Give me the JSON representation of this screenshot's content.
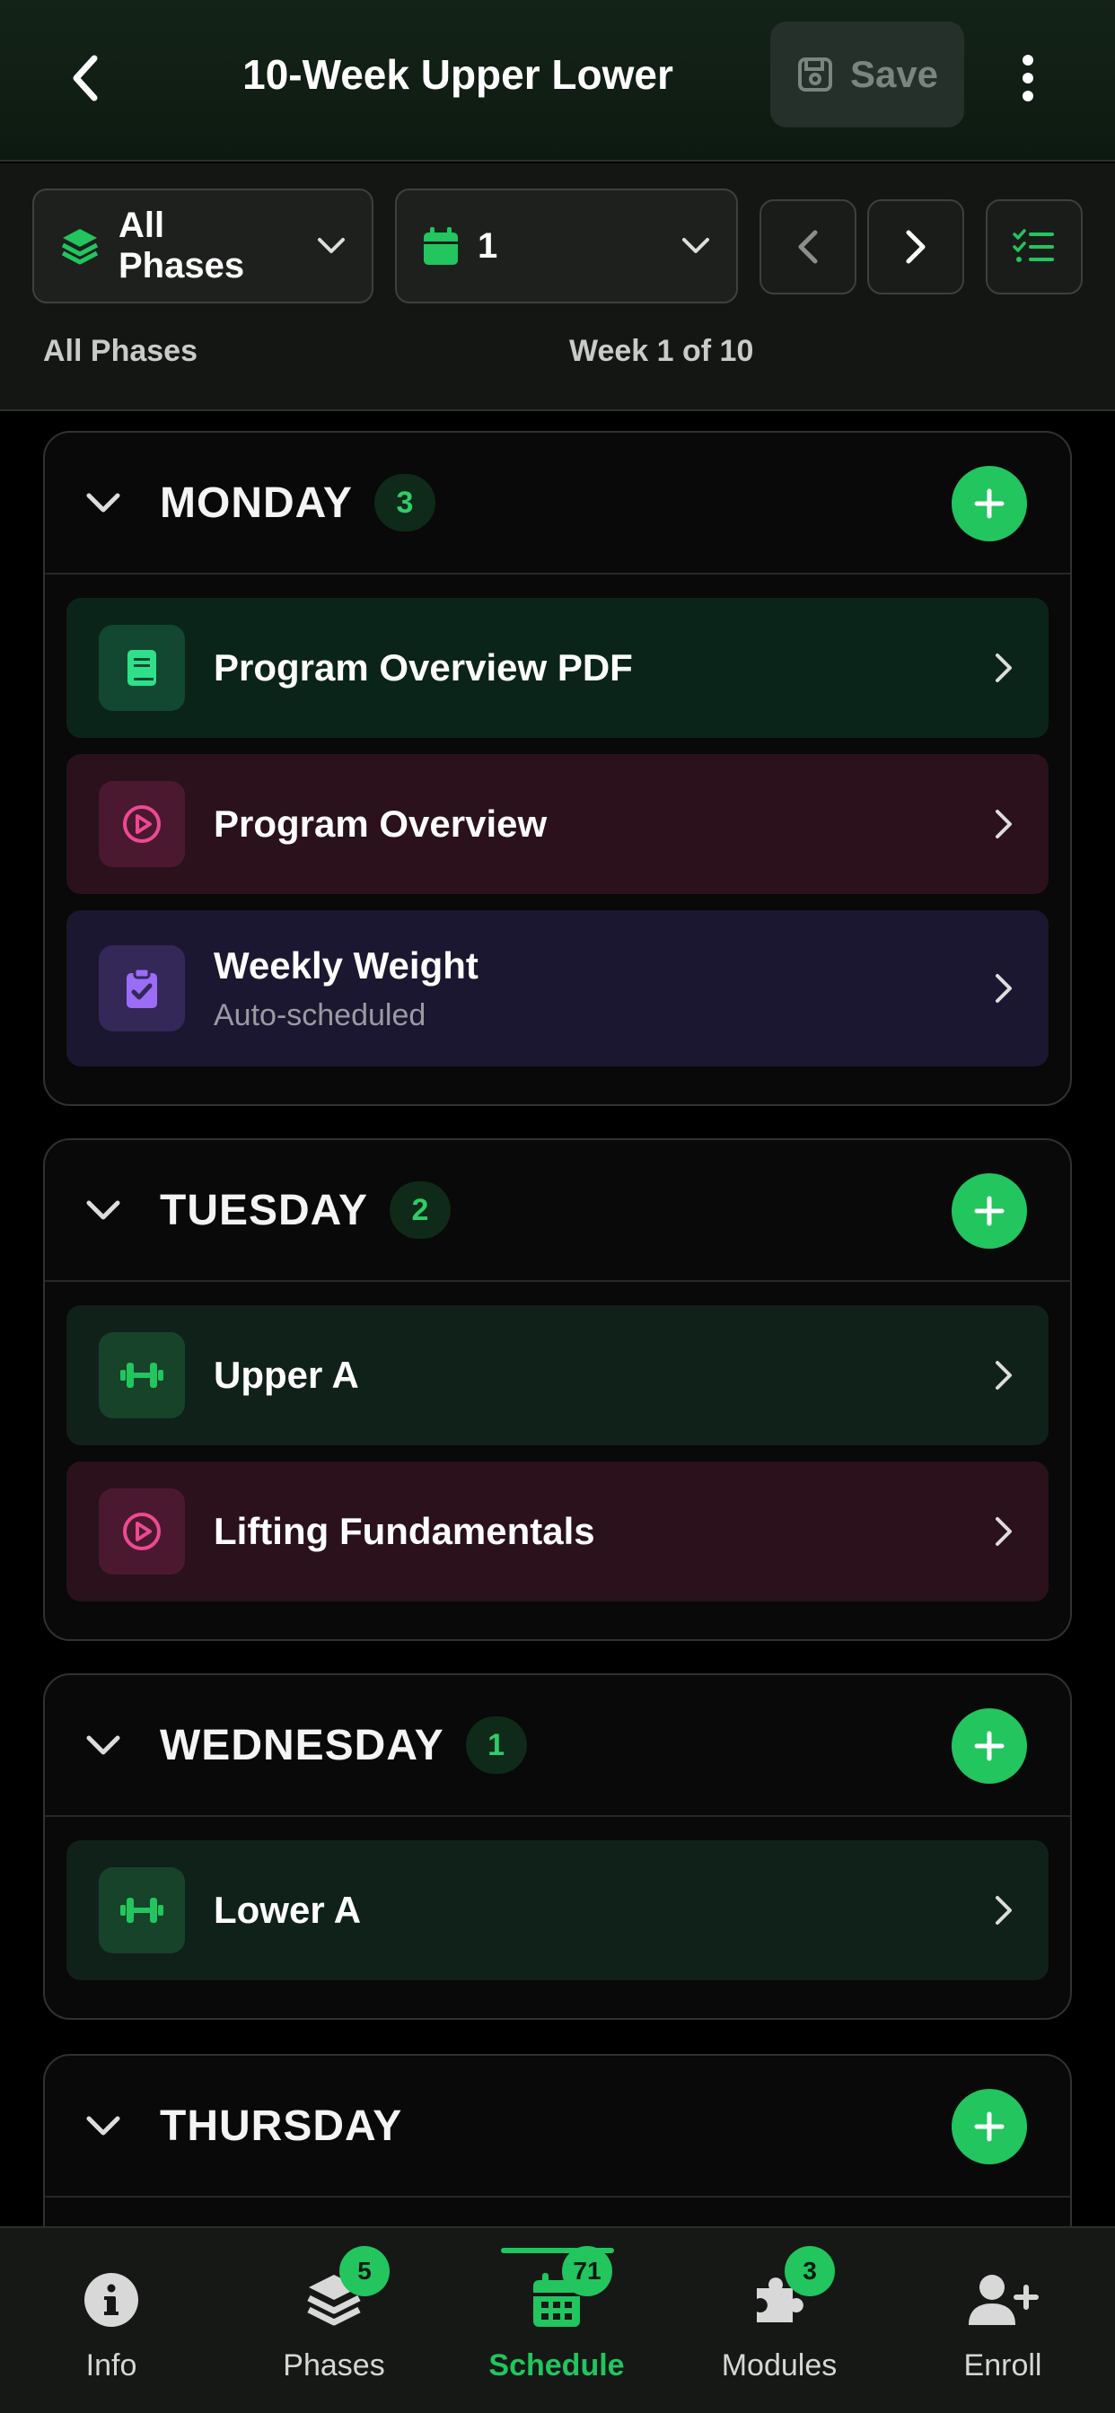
{
  "header": {
    "title": "10-Week Upper Lower",
    "save_label": "Save"
  },
  "toolbar": {
    "phase_select": "All Phases",
    "week_select": "1",
    "phase_caption": "All Phases",
    "week_caption": "Week 1 of 10"
  },
  "days": [
    {
      "name": "MONDAY",
      "count": "3",
      "items": [
        {
          "title": "Program Overview PDF",
          "subtitle": "",
          "icon": "document-icon",
          "kind": "document"
        },
        {
          "title": "Program Overview",
          "subtitle": "",
          "icon": "play-circle-icon",
          "kind": "video"
        },
        {
          "title": "Weekly Weight",
          "subtitle": "Auto-scheduled",
          "icon": "clipboard-check-icon",
          "kind": "check-in"
        }
      ]
    },
    {
      "name": "TUESDAY",
      "count": "2",
      "items": [
        {
          "title": "Upper A",
          "subtitle": "",
          "icon": "dumbbell-icon",
          "kind": "workout"
        },
        {
          "title": "Lifting Fundamentals",
          "subtitle": "",
          "icon": "play-circle-icon",
          "kind": "video"
        }
      ]
    },
    {
      "name": "WEDNESDAY",
      "count": "1",
      "items": [
        {
          "title": "Lower A",
          "subtitle": "",
          "icon": "dumbbell-icon",
          "kind": "workout"
        }
      ]
    },
    {
      "name": "THURSDAY",
      "count": "",
      "items": []
    }
  ],
  "bottom_nav": {
    "tabs": [
      {
        "label": "Info",
        "badge": "",
        "icon": "info-icon"
      },
      {
        "label": "Phases",
        "badge": "5",
        "icon": "layers-icon"
      },
      {
        "label": "Schedule",
        "badge": "71",
        "icon": "calendar-icon",
        "active": true
      },
      {
        "label": "Modules",
        "badge": "3",
        "icon": "puzzle-icon"
      },
      {
        "label": "Enroll",
        "badge": "",
        "icon": "user-plus-icon"
      }
    ]
  },
  "colors": {
    "accent": "#22c55e",
    "background": "#000000",
    "video_accent": "#e83e8c",
    "checkin_accent": "#8b5cf6"
  }
}
